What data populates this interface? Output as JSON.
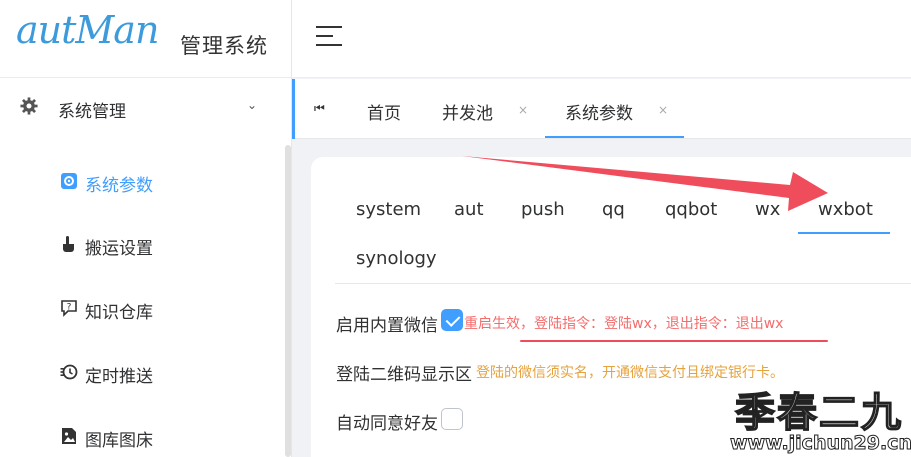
{
  "brand": {
    "script": "autMan",
    "name": "管理系统"
  },
  "sidebar": {
    "group_label": "系统管理",
    "items": [
      {
        "label": "系统参数"
      },
      {
        "label": "搬运设置"
      },
      {
        "label": "知识仓库"
      },
      {
        "label": "定时推送"
      },
      {
        "label": "图库图床"
      }
    ]
  },
  "tabs": {
    "home": "首页",
    "pool": "并发池",
    "params": "系统参数",
    "close": "×"
  },
  "subtabs": [
    "system",
    "aut",
    "push",
    "qq",
    "qqbot",
    "wx",
    "wxbot",
    "synology"
  ],
  "settings": {
    "builtin_wechat_label": "启用内置微信",
    "builtin_wechat_hint": "重启生效，登陆指令：登陆wx，退出指令：退出wx",
    "qr_label": "登陆二维码显示区",
    "qr_hint": "登陆的微信须实名，开通微信支付且绑定银行卡。",
    "auto_friend_label": "自动同意好友"
  },
  "watermark": {
    "cn": "季春二九",
    "url": "www.jichun29.cn"
  },
  "colors": {
    "accent": "#409eff",
    "red_hint": "#f56c6c",
    "orange_hint": "#e6a23c",
    "arrow": "#f04d5c"
  }
}
